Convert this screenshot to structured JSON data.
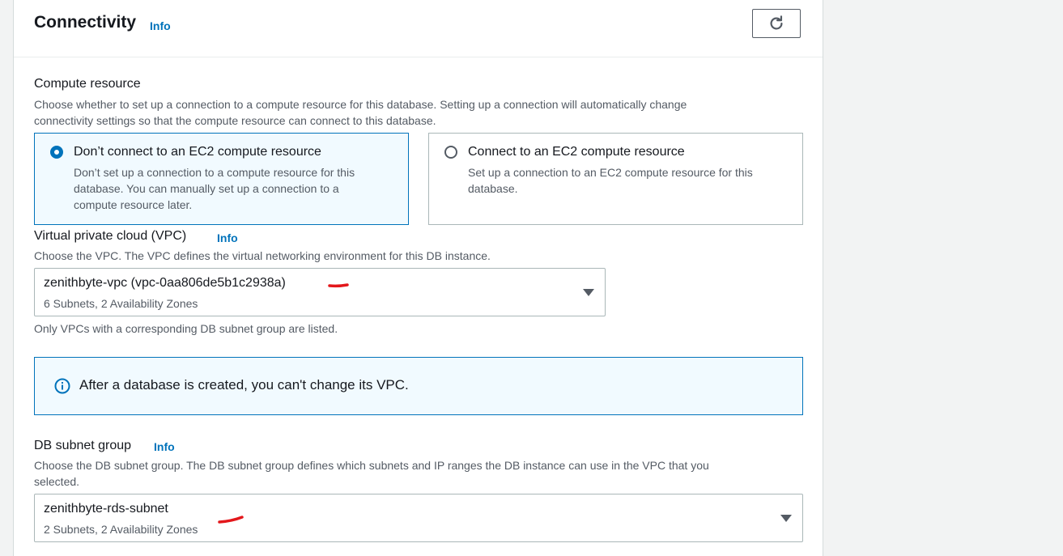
{
  "section": {
    "title": "Connectivity",
    "info": "Info"
  },
  "compute": {
    "label": "Compute resource",
    "description_line1": "Choose whether to set up a connection to a compute resource for this database. Setting up a connection will automatically change",
    "description_line2": "connectivity settings so that the compute resource can connect to this database.",
    "options": [
      {
        "title": "Don’t connect to an EC2 compute resource",
        "desc_line1": "Don’t set up a connection to a compute resource for this",
        "desc_line2": "database. You can manually set up a connection to a",
        "desc_line3": "compute resource later.",
        "selected": true
      },
      {
        "title": "Connect to an EC2 compute resource",
        "desc_line1": "Set up a connection to an EC2 compute resource for this",
        "desc_line2": "database.",
        "selected": false
      }
    ]
  },
  "vpc": {
    "label": "Virtual private cloud (VPC)",
    "info": "Info",
    "description": "Choose the VPC. The VPC defines the virtual networking environment for this DB instance.",
    "selected_value": "zenithbyte-vpc (vpc-0aa806de5b1c2938a)",
    "selected_sub": "6 Subnets, 2 Availability Zones",
    "hint": "Only VPCs with a corresponding DB subnet group are listed."
  },
  "alert": {
    "text": "After a database is created, you can't change its VPC."
  },
  "subnet": {
    "label": "DB subnet group",
    "info": "Info",
    "description_line1": "Choose the DB subnet group. The DB subnet group defines which subnets and IP ranges the DB instance can use in the VPC that you",
    "description_line2": "selected.",
    "selected_value": "zenithbyte-rds-subnet",
    "selected_sub": "2 Subnets, 2 Availability Zones"
  },
  "colors": {
    "accent": "#0073bb",
    "annotation": "#e3171b"
  }
}
